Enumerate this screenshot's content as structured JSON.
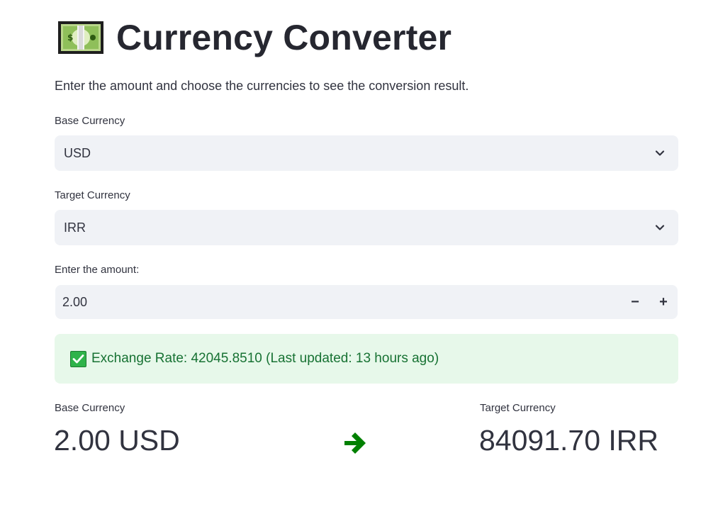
{
  "header": {
    "title": "Currency Converter",
    "icon": "dollar-banknote-icon"
  },
  "intro_text": "Enter the amount and choose the currencies to see the conversion result.",
  "form": {
    "base_currency": {
      "label": "Base Currency",
      "selected": "USD"
    },
    "target_currency": {
      "label": "Target Currency",
      "selected": "IRR"
    },
    "amount": {
      "label": "Enter the amount:",
      "value": "2.00",
      "decrement_label": "−",
      "increment_label": "+"
    }
  },
  "status": {
    "icon": "check-mark-icon",
    "text": "Exchange Rate: 42045.8510 (Last updated: 13 hours ago)"
  },
  "result": {
    "base": {
      "label": "Base Currency",
      "value": "2.00 USD"
    },
    "arrow_icon": "right-arrow-icon",
    "target": {
      "label": "Target Currency",
      "value": "84091.70 IRR"
    }
  },
  "colors": {
    "title": "#262730",
    "text": "#31333f",
    "input_bg": "#f0f2f6",
    "success_bg": "#e7f8ea",
    "success_text": "#177233",
    "check_green": "#2fb34a",
    "arrow_green": "#008000"
  }
}
